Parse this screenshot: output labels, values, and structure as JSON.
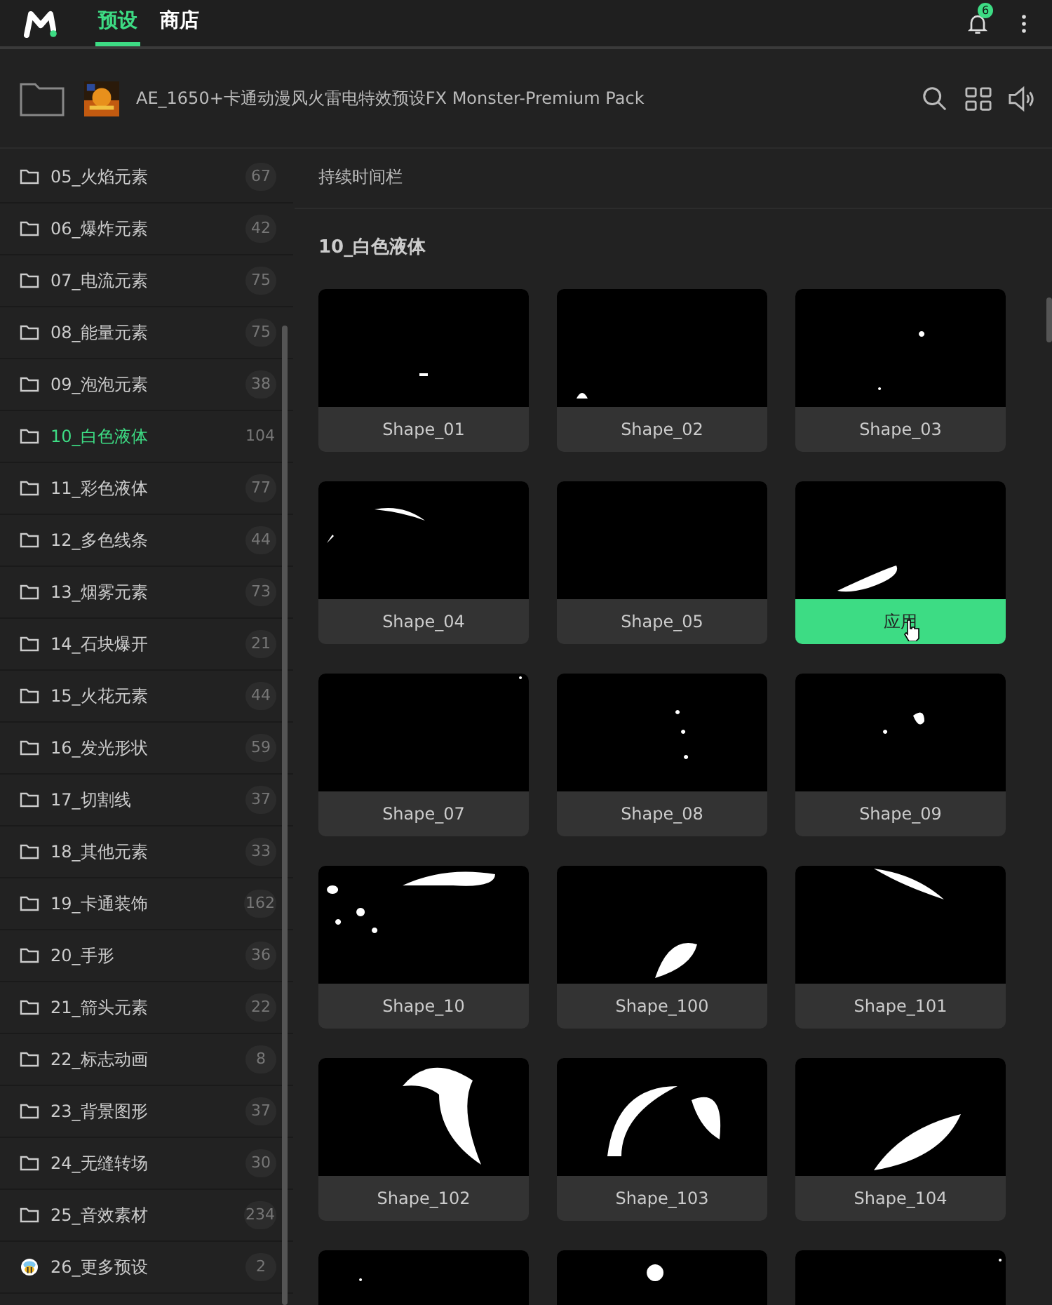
{
  "top_tabs": [
    {
      "label": "预设",
      "selected": true
    },
    {
      "label": "商店",
      "selected": false
    }
  ],
  "notifications": {
    "badge": "6"
  },
  "pack": {
    "title": "AE_1650+卡通动漫风火雷电特效预设FX Monster-Premium Pack"
  },
  "sidebar": {
    "items": [
      {
        "label": "05_火焰元素",
        "count": "67",
        "kind": "folder",
        "selected": false
      },
      {
        "label": "06_爆炸元素",
        "count": "42",
        "kind": "folder",
        "selected": false
      },
      {
        "label": "07_电流元素",
        "count": "75",
        "kind": "folder",
        "selected": false
      },
      {
        "label": "08_能量元素",
        "count": "75",
        "kind": "folder",
        "selected": false
      },
      {
        "label": "09_泡泡元素",
        "count": "38",
        "kind": "folder",
        "selected": false
      },
      {
        "label": "10_白色液体",
        "count": "104",
        "kind": "folder",
        "selected": true
      },
      {
        "label": "11_彩色液体",
        "count": "77",
        "kind": "folder",
        "selected": false
      },
      {
        "label": "12_多色线条",
        "count": "44",
        "kind": "folder",
        "selected": false
      },
      {
        "label": "13_烟雾元素",
        "count": "73",
        "kind": "folder",
        "selected": false
      },
      {
        "label": "14_石块爆开",
        "count": "21",
        "kind": "folder",
        "selected": false
      },
      {
        "label": "15_火花元素",
        "count": "44",
        "kind": "folder",
        "selected": false
      },
      {
        "label": "16_发光形状",
        "count": "59",
        "kind": "folder",
        "selected": false
      },
      {
        "label": "17_切割线",
        "count": "37",
        "kind": "folder",
        "selected": false
      },
      {
        "label": "18_其他元素",
        "count": "33",
        "kind": "folder",
        "selected": false
      },
      {
        "label": "19_卡通装饰",
        "count": "162",
        "kind": "folder",
        "selected": false
      },
      {
        "label": "20_手形",
        "count": "36",
        "kind": "folder",
        "selected": false
      },
      {
        "label": "21_箭头元素",
        "count": "22",
        "kind": "folder",
        "selected": false
      },
      {
        "label": "22_标志动画",
        "count": "8",
        "kind": "folder",
        "selected": false
      },
      {
        "label": "23_背景图形",
        "count": "37",
        "kind": "folder",
        "selected": false
      },
      {
        "label": "24_无缝转场",
        "count": "30",
        "kind": "folder",
        "selected": false
      },
      {
        "label": "25_音效素材",
        "count": "234",
        "kind": "folder",
        "selected": false
      },
      {
        "label": "26_更多预设",
        "count": "2",
        "kind": "bee",
        "selected": false
      }
    ]
  },
  "content": {
    "section_link": "持续时间栏",
    "heading": "10_白色液体",
    "cards": [
      {
        "kind": "normal",
        "label": "Shape_01"
      },
      {
        "kind": "normal",
        "label": "Shape_02"
      },
      {
        "kind": "normal",
        "label": "Shape_03"
      },
      {
        "kind": "normal",
        "label": "Shape_04"
      },
      {
        "kind": "normal",
        "label": "Shape_05"
      },
      {
        "kind": "hover",
        "label": "应用"
      },
      {
        "kind": "normal",
        "label": "Shape_07"
      },
      {
        "kind": "normal",
        "label": "Shape_08"
      },
      {
        "kind": "normal",
        "label": "Shape_09"
      },
      {
        "kind": "normal",
        "label": "Shape_10"
      },
      {
        "kind": "normal",
        "label": "Shape_100"
      },
      {
        "kind": "normal",
        "label": "Shape_101"
      },
      {
        "kind": "normal",
        "label": "Shape_102"
      },
      {
        "kind": "normal",
        "label": "Shape_103"
      },
      {
        "kind": "normal",
        "label": "Shape_104"
      },
      {
        "kind": "cut"
      },
      {
        "kind": "cut"
      },
      {
        "kind": "cut"
      }
    ]
  }
}
